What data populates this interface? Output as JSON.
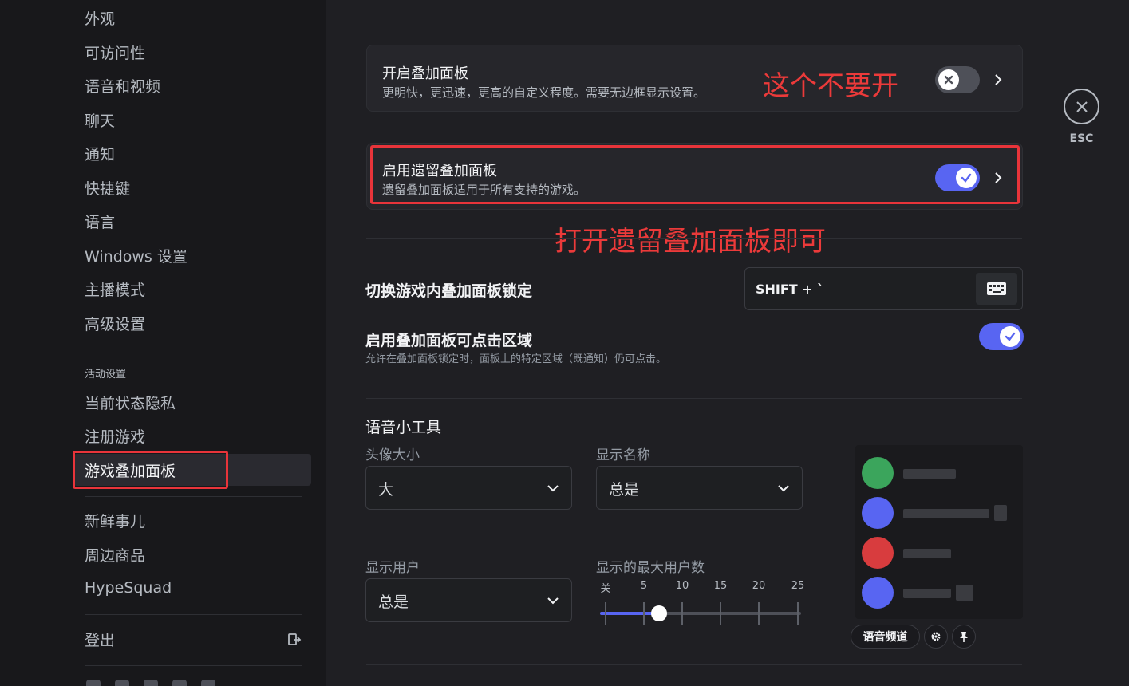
{
  "sidebar": {
    "items": [
      {
        "label": "外观"
      },
      {
        "label": "可访问性"
      },
      {
        "label": "语音和视频"
      },
      {
        "label": "聊天"
      },
      {
        "label": "通知"
      },
      {
        "label": "快捷键"
      },
      {
        "label": "语言"
      },
      {
        "label": "Windows 设置"
      },
      {
        "label": "主播模式"
      },
      {
        "label": "高级设置"
      }
    ],
    "activity_header": "活动设置",
    "activity_items": [
      {
        "label": "当前状态隐私"
      },
      {
        "label": "注册游戏"
      },
      {
        "label": "游戏叠加面板"
      }
    ],
    "extra_items": [
      {
        "label": "新鲜事儿"
      },
      {
        "label": "周边商品"
      },
      {
        "label": "HypeSquad"
      }
    ],
    "logout_label": "登出"
  },
  "overlay": {
    "title": "开启叠加面板",
    "desc": "更明快，更迅速，更高的自定义程度。需要无边框显示设置。",
    "enabled": false
  },
  "legacy": {
    "title": "启用遗留叠加面板",
    "desc": "遗留叠加面板适用于所有支持的游戏。",
    "enabled": true
  },
  "annotations": {
    "overlay_note": "这个不要开",
    "legacy_note": "打开遗留叠加面板即可"
  },
  "lock": {
    "title": "切换游戏内叠加面板锁定",
    "keybind": "SHIFT + `"
  },
  "clickable": {
    "title": "启用叠加面板可点击区域",
    "desc": "允许在叠加面板锁定时，面板上的特定区域（既通知）仍可点击。",
    "enabled": true
  },
  "voice_widget": {
    "title": "语音小工具",
    "avatar_size_label": "头像大小",
    "avatar_size_value": "大",
    "display_names_label": "显示名称",
    "display_names_value": "总是",
    "display_users_label": "显示用户",
    "display_users_value": "总是",
    "max_users_label": "显示的最大用户数",
    "max_users_ticks": [
      "关",
      "5",
      "10",
      "15",
      "20",
      "25"
    ],
    "max_users_value": 7,
    "preview_channel_label": "语音频道"
  },
  "esc_label": "ESC",
  "colors": {
    "accent": "#5865f2",
    "annotation_red": "#ec3a3a"
  }
}
